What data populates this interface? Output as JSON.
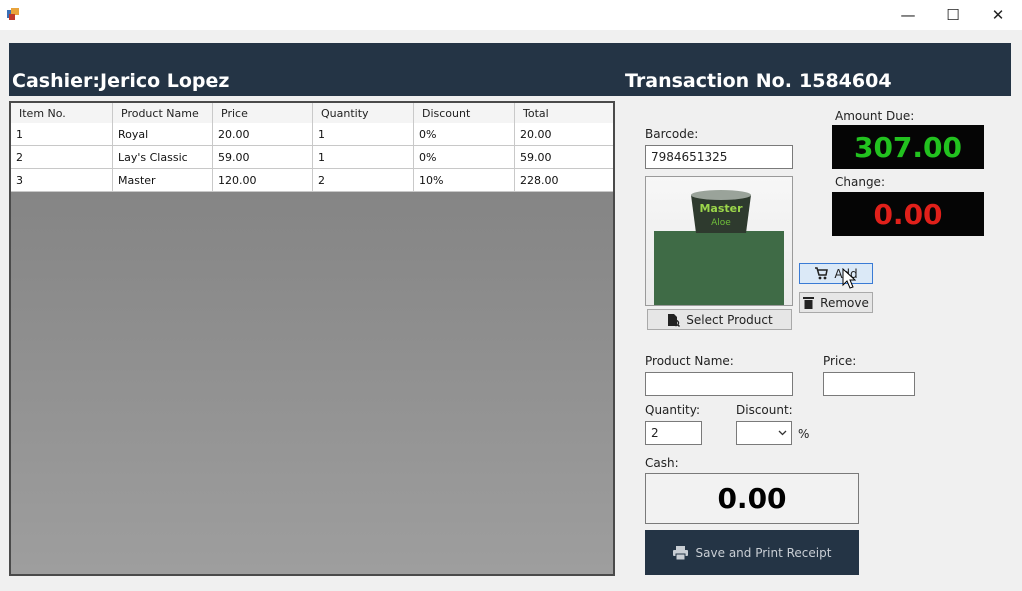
{
  "window": {
    "minimize_glyph": "—",
    "maximize_glyph": "☐",
    "close_glyph": "✕"
  },
  "header": {
    "cashier_label": "Cashier:",
    "cashier_name": "Jerico Lopez",
    "transaction_label": "Transaction No.",
    "transaction_no": "1584604"
  },
  "grid": {
    "columns": [
      "Item No.",
      "Product Name",
      "Price",
      "Quantity",
      "Discount",
      "Total"
    ],
    "rows": [
      [
        "1",
        "Royal",
        "20.00",
        "1",
        "0%",
        "20.00"
      ],
      [
        "2",
        "Lay's Classic",
        "59.00",
        "1",
        "0%",
        "59.00"
      ],
      [
        "3",
        "Master",
        "120.00",
        "2",
        "10%",
        "228.00"
      ]
    ]
  },
  "barcode": {
    "label": "Barcode:",
    "value": "7984651325"
  },
  "amount_due": {
    "label": "Amount Due:",
    "value": "307.00",
    "color": "#22c21f"
  },
  "change": {
    "label": "Change:",
    "value": "0.00",
    "color": "#e0201a"
  },
  "buttons": {
    "add": "Add",
    "remove": "Remove",
    "select_product": "Select Product",
    "save_print": "Save and Print Receipt"
  },
  "product_image": {
    "brand_text": "Master",
    "sub_text": "Aloe"
  },
  "form": {
    "product_name_label": "Product Name:",
    "product_name_value": "",
    "price_label": "Price:",
    "price_value": "",
    "quantity_label": "Quantity:",
    "quantity_value": "2",
    "discount_label": "Discount:",
    "discount_value": "",
    "percent_sign": "%"
  },
  "cash": {
    "label": "Cash:",
    "value": "0.00"
  },
  "colors": {
    "header_bg": "#243445",
    "accent": "#3a7bd5"
  }
}
